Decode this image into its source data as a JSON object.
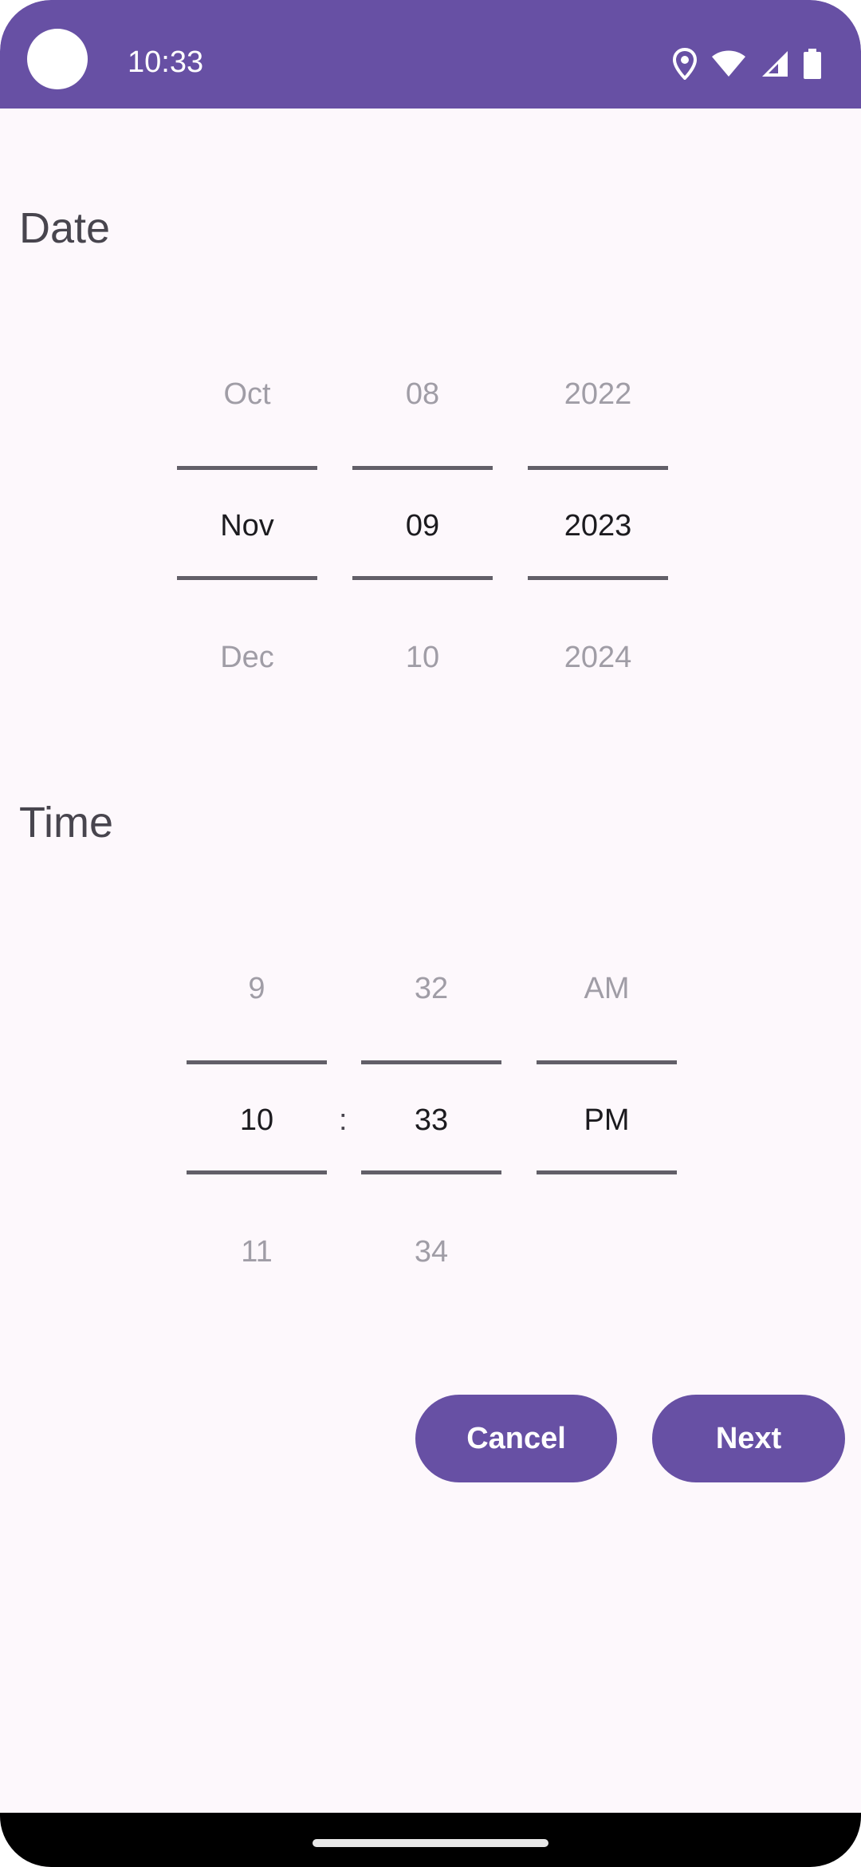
{
  "status_bar": {
    "time": "10:33",
    "icons": [
      "location-icon",
      "wifi-icon",
      "signal-icon",
      "battery-icon"
    ],
    "background": "#6750a4"
  },
  "date_section": {
    "title": "Date",
    "month": {
      "prev": "Oct",
      "current": "Nov",
      "next": "Dec"
    },
    "day": {
      "prev": "08",
      "current": "09",
      "next": "10"
    },
    "year": {
      "prev": "2022",
      "current": "2023",
      "next": "2024"
    }
  },
  "time_section": {
    "title": "Time",
    "hour": {
      "prev": "9",
      "current": "10",
      "next": "11"
    },
    "separator": ":",
    "minute": {
      "prev": "32",
      "current": "33",
      "next": "34"
    },
    "period": {
      "prev": "AM",
      "current": "PM"
    }
  },
  "actions": {
    "cancel_label": "Cancel",
    "next_label": "Next",
    "accent": "#6750a4"
  }
}
